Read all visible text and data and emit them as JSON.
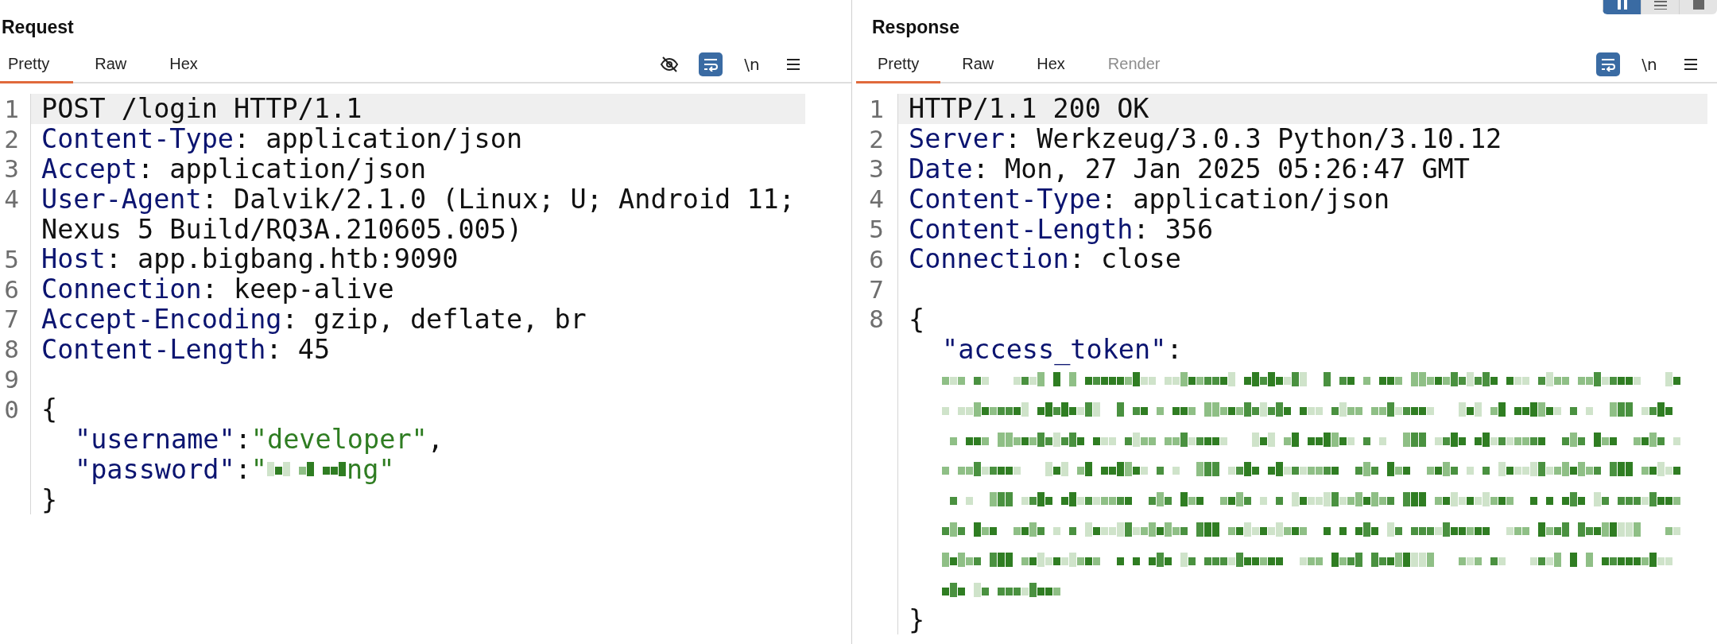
{
  "layout_buttons": [
    {
      "selected": true
    },
    {
      "selected": false
    },
    {
      "selected": false
    }
  ],
  "panes": [
    {
      "title": "Request",
      "tabs": [
        {
          "label": "Pretty",
          "selected": true,
          "disabled": false
        },
        {
          "label": "Raw",
          "selected": false,
          "disabled": false
        },
        {
          "label": "Hex",
          "selected": false,
          "disabled": false
        }
      ],
      "tools": [
        {
          "kind": "hide"
        },
        {
          "kind": "wrap"
        },
        {
          "kind": "newline",
          "label": "\\n"
        },
        {
          "kind": "menu"
        }
      ],
      "lines": [
        {
          "number": "1",
          "highlighted": true,
          "indented": false,
          "parts": [
            {
              "text": "POST /login HTTP/1.1"
            }
          ]
        },
        {
          "number": "2",
          "highlighted": false,
          "indented": false,
          "parts": [
            {
              "key": "Content-Type"
            },
            {
              "text": ": application/json"
            }
          ]
        },
        {
          "number": "3",
          "highlighted": false,
          "indented": false,
          "parts": [
            {
              "key": "Accept"
            },
            {
              "text": ": application/json"
            }
          ]
        },
        {
          "number": "4",
          "highlighted": false,
          "indented": false,
          "parts": [
            {
              "key": "User-Agent"
            },
            {
              "text": ": Dalvik/2.1.0 (Linux; U; Android 11;"
            }
          ]
        },
        {
          "highlighted": false,
          "indented": false,
          "parts": [
            {
              "text": "Nexus 5 Build/RQ3A.210605.005)"
            }
          ]
        },
        {
          "number": "5",
          "highlighted": false,
          "indented": false,
          "parts": [
            {
              "key": "Host"
            },
            {
              "text": ": app.bigbang.htb:9090"
            }
          ]
        },
        {
          "number": "6",
          "highlighted": false,
          "indented": false,
          "parts": [
            {
              "key": "Connection"
            },
            {
              "text": ": keep-alive"
            }
          ]
        },
        {
          "number": "7",
          "highlighted": false,
          "indented": false,
          "parts": [
            {
              "key": "Accept-Encoding"
            },
            {
              "text": ": gzip, deflate, br"
            }
          ]
        },
        {
          "number": "8",
          "highlighted": false,
          "indented": false,
          "parts": [
            {
              "key": "Content-Length"
            },
            {
              "text": ": 45"
            }
          ]
        },
        {
          "number": "9",
          "highlighted": false
        },
        {
          "number": "0",
          "highlighted": false,
          "indented": false,
          "parts": [
            {
              "text": "{"
            }
          ]
        },
        {
          "highlighted": false,
          "indented": true,
          "parts": [
            {
              "key": "\"username\""
            },
            {
              "text": ":"
            },
            {
              "string": "\"developer\""
            },
            {
              "text": ","
            }
          ]
        },
        {
          "highlighted": false,
          "indented": true,
          "parts": [
            {
              "key": "\"password\""
            },
            {
              "text": ":"
            },
            {
              "string": "\""
            },
            {
              "redacted_word": true
            },
            {
              "string": "ng\""
            }
          ]
        },
        {
          "highlighted": false,
          "indented": false,
          "parts": [
            {
              "text": "}"
            }
          ]
        }
      ]
    },
    {
      "title": "Response",
      "tabs": [
        {
          "label": "Pretty",
          "selected": true,
          "disabled": false
        },
        {
          "label": "Raw",
          "selected": false,
          "disabled": false
        },
        {
          "label": "Hex",
          "selected": false,
          "disabled": false
        },
        {
          "label": "Render",
          "selected": false,
          "disabled": true
        }
      ],
      "tools": [
        {
          "kind": "wrap"
        },
        {
          "kind": "newline",
          "label": "\\n"
        },
        {
          "kind": "menu"
        }
      ],
      "lines": [
        {
          "number": "1",
          "highlighted": true,
          "indented": false,
          "parts": [
            {
              "text": "HTTP/1.1 200 OK"
            }
          ]
        },
        {
          "number": "2",
          "highlighted": false,
          "indented": false,
          "parts": [
            {
              "key": "Server"
            },
            {
              "text": ": Werkzeug/3.0.3 Python/3.10.12"
            }
          ]
        },
        {
          "number": "3",
          "highlighted": false,
          "indented": false,
          "parts": [
            {
              "key": "Date"
            },
            {
              "text": ": Mon, 27 Jan 2025 05:26:47 GMT"
            }
          ]
        },
        {
          "number": "4",
          "highlighted": false,
          "indented": false,
          "parts": [
            {
              "key": "Content-Type"
            },
            {
              "text": ": application/json"
            }
          ]
        },
        {
          "number": "5",
          "highlighted": false,
          "indented": false,
          "parts": [
            {
              "key": "Content-Length"
            },
            {
              "text": ": 356"
            }
          ]
        },
        {
          "number": "6",
          "highlighted": false,
          "indented": false,
          "parts": [
            {
              "key": "Connection"
            },
            {
              "text": ": close"
            }
          ]
        },
        {
          "number": "7",
          "highlighted": false
        },
        {
          "number": "8",
          "highlighted": false,
          "indented": false,
          "parts": [
            {
              "text": "{"
            }
          ]
        },
        {
          "highlighted": false,
          "indented": true,
          "parts": [
            {
              "key": "\"access_token\""
            },
            {
              "text": ":"
            }
          ]
        },
        {
          "highlighted": false,
          "indented": true,
          "parts": [
            {
              "redacted_line": true
            }
          ]
        },
        {
          "highlighted": false,
          "indented": true,
          "parts": [
            {
              "redacted_line": true
            }
          ]
        },
        {
          "highlighted": false,
          "indented": true,
          "parts": [
            {
              "redacted_line": true
            }
          ]
        },
        {
          "highlighted": false,
          "indented": true,
          "parts": [
            {
              "redacted_line": true
            }
          ]
        },
        {
          "highlighted": false,
          "indented": true,
          "parts": [
            {
              "redacted_line": true
            }
          ]
        },
        {
          "highlighted": false,
          "indented": true,
          "parts": [
            {
              "redacted_line": true
            }
          ]
        },
        {
          "highlighted": false,
          "indented": true,
          "parts": [
            {
              "redacted_line": true
            }
          ]
        },
        {
          "highlighted": false,
          "indented": true,
          "parts": [
            {
              "redacted_tail": true
            }
          ]
        },
        {
          "highlighted": false,
          "indented": false,
          "parts": [
            {
              "text": "}"
            }
          ]
        }
      ]
    }
  ]
}
